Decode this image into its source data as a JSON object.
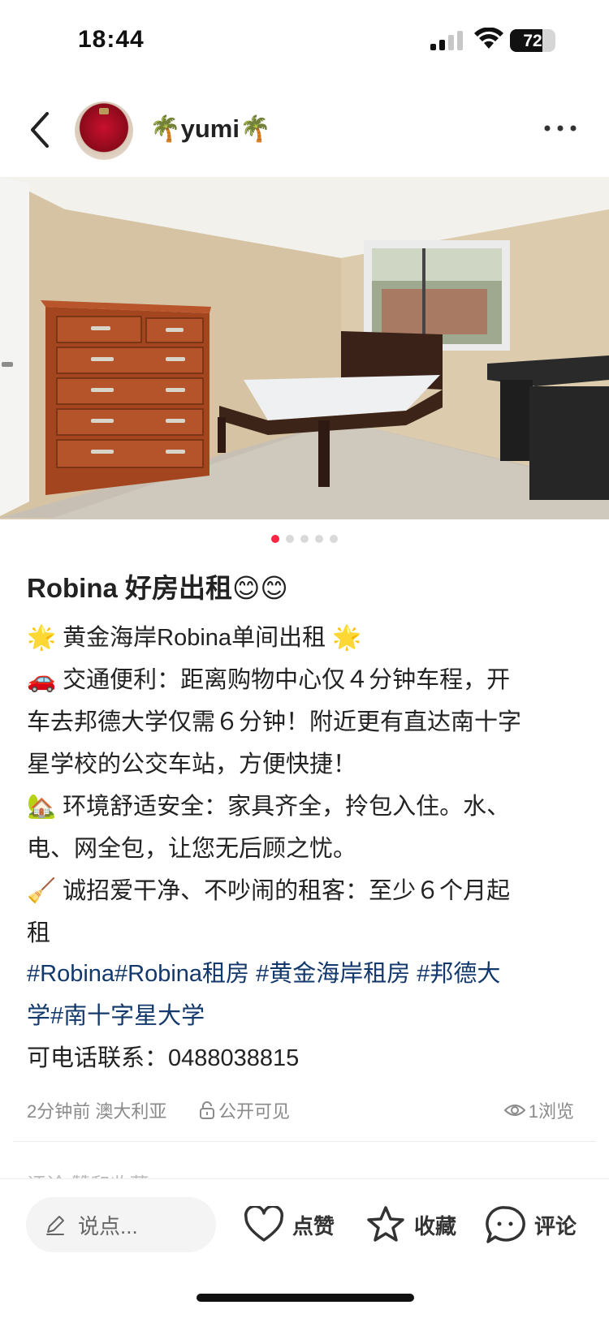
{
  "status_bar": {
    "time": "18:44",
    "battery": "72",
    "battery_level": 0.72
  },
  "header": {
    "author": "🌴yumi🌴",
    "icons": {
      "back": "chevron-left-icon",
      "more": "more-dots-icon"
    }
  },
  "carousel": {
    "count": 5,
    "active_index": 0
  },
  "post": {
    "title": "Robina 好房出租😊😊",
    "lines": [
      "🌟 黄金海岸Robina单间出租 🌟",
      "🚗 交通便利：距离购物中心仅４分钟车程，开",
      "车去邦德大学仅需６分钟！附近更有直达南十字",
      "星学校的公交车站，方便快捷！",
      "🏡 环境舒适安全：家具齐全，拎包入住。水、",
      "电、网全包，让您无后顾之忧。",
      "🧹 诚招爱干净、不吵闹的租客：至少６个月起",
      "租"
    ],
    "tags_line1": "#Robina#Robina租房 #黄金海岸租房 #邦德大",
    "tags_line2": "学#南十字星大学",
    "contact": "可电话联系：0488038815"
  },
  "meta": {
    "time_location": "2分钟前 澳大利亚",
    "visibility": "公开可见",
    "views": "1浏览"
  },
  "comments_peek": "评论    赞和收藏",
  "bottom_bar": {
    "input_placeholder": "说点...",
    "like_label": "点赞",
    "fav_label": "收藏",
    "comment_label": "评论"
  },
  "colors": {
    "accent": "#ff2442",
    "tag": "#13386c"
  }
}
